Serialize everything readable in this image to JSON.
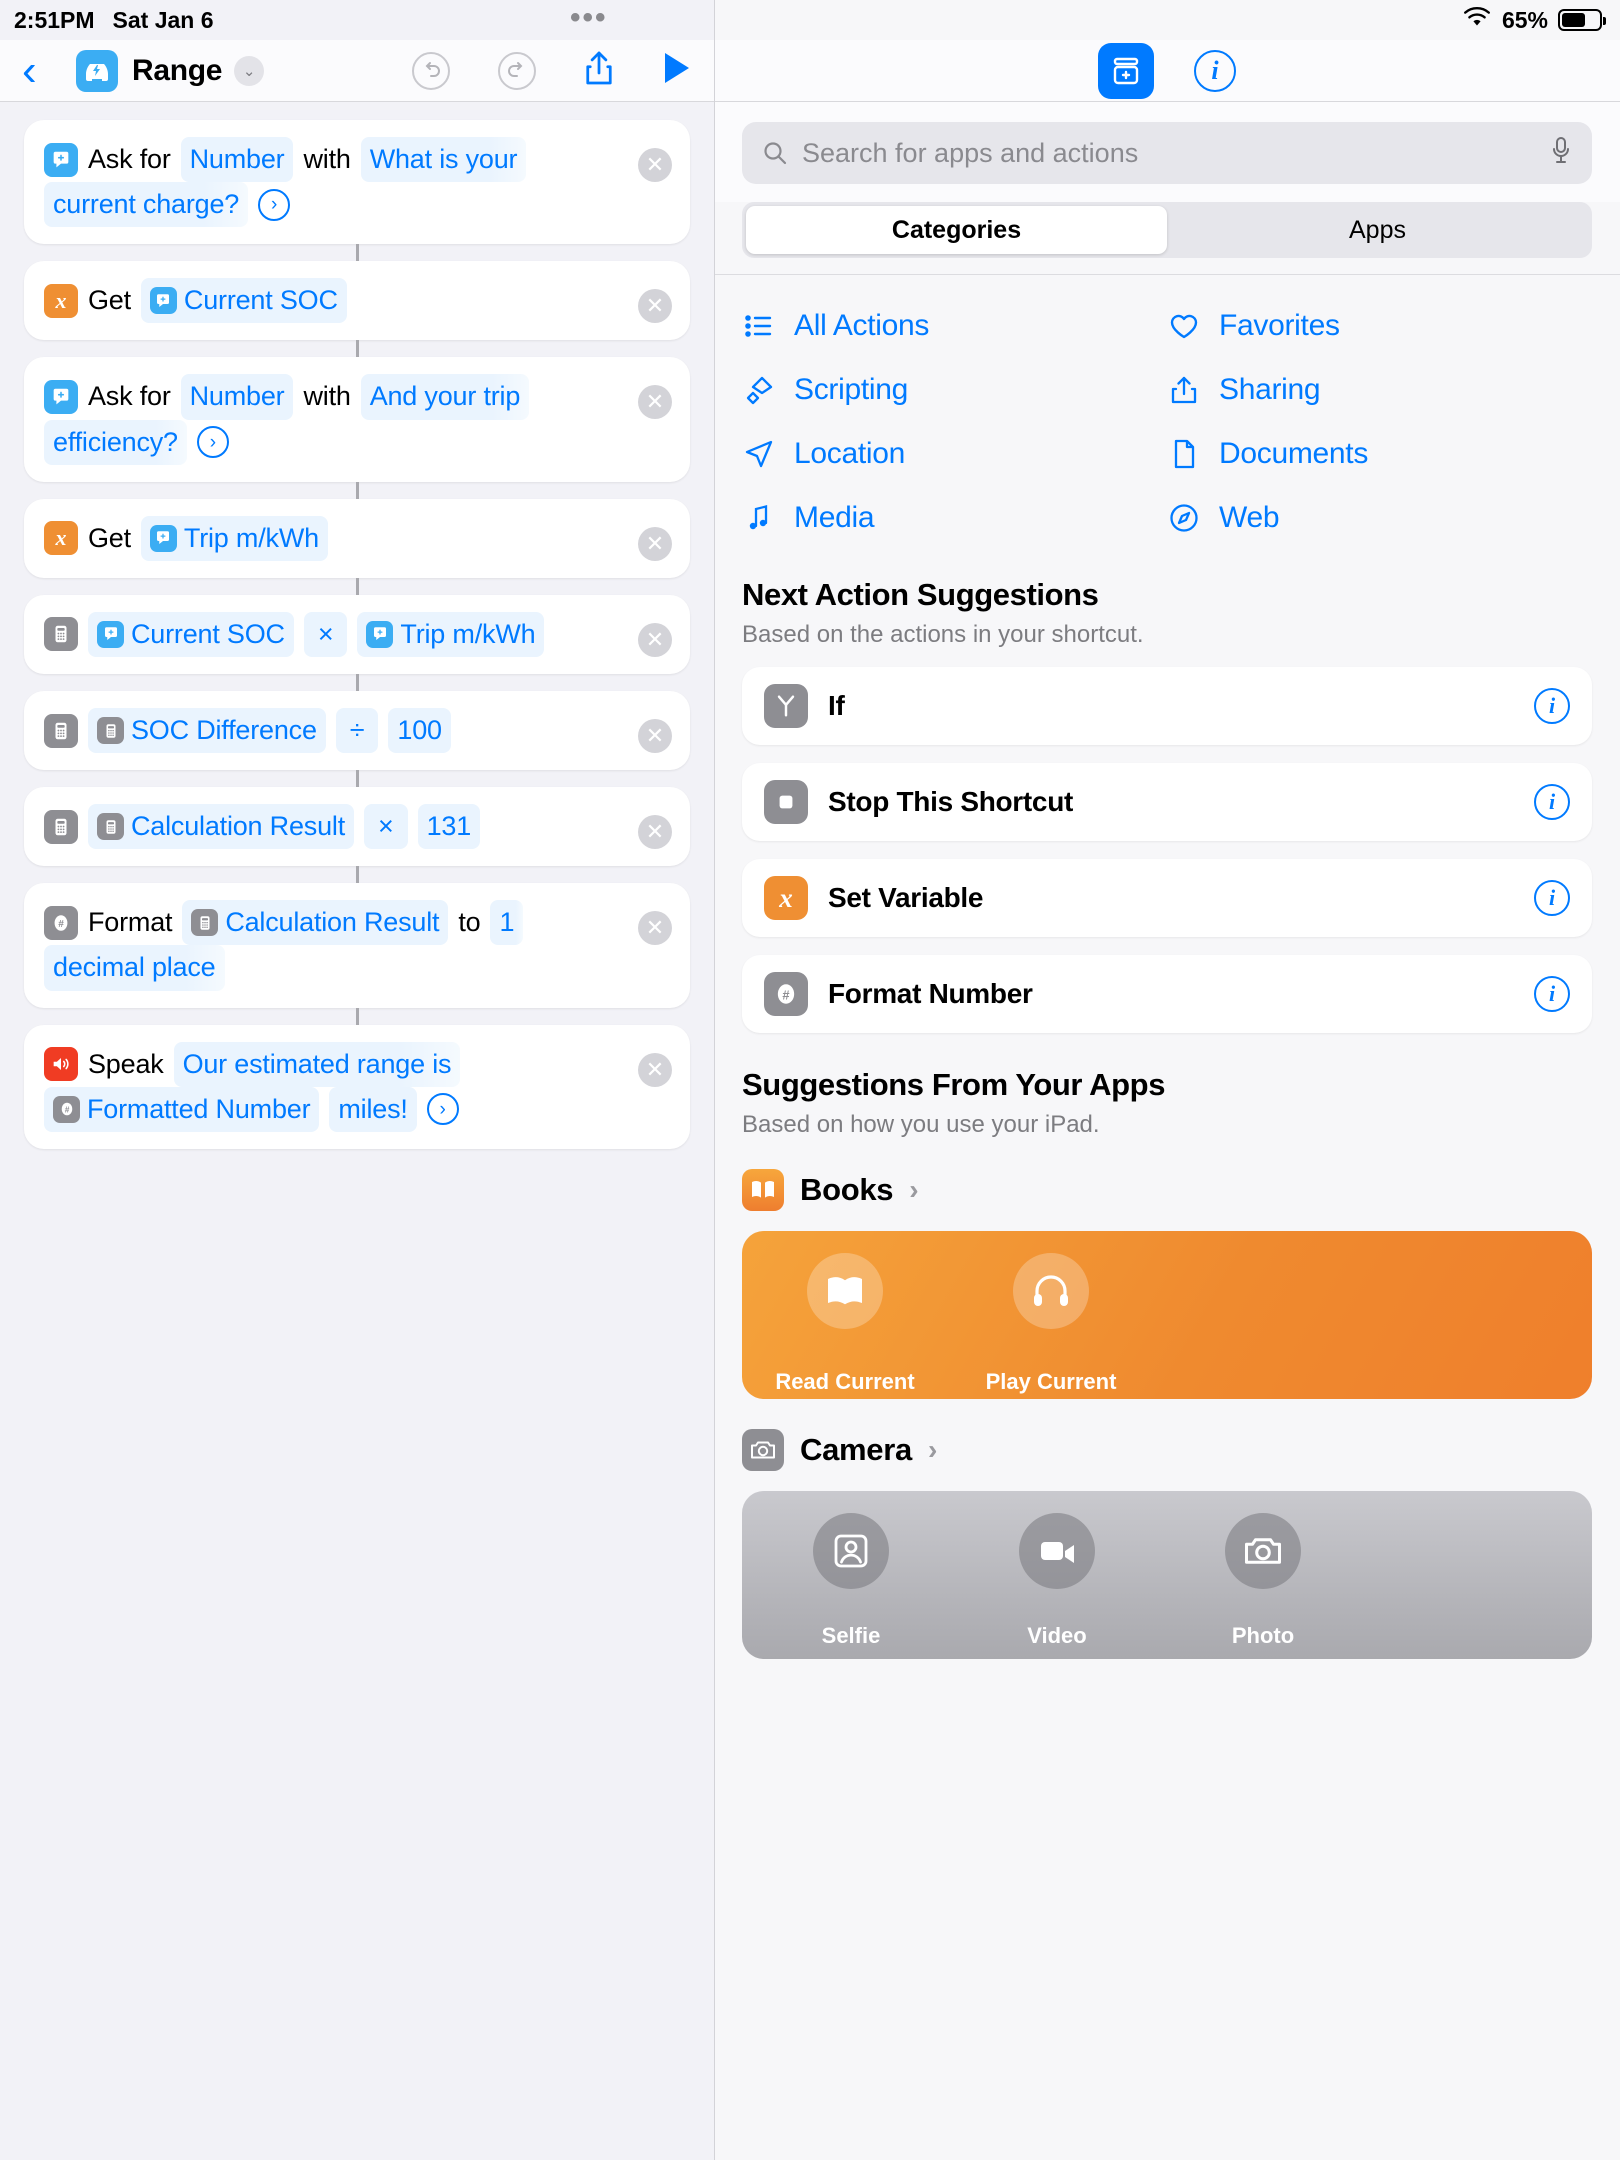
{
  "statusbar": {
    "time": "2:51PM",
    "date": "Sat Jan 6",
    "dots": "•••",
    "battery_percent": "65%"
  },
  "editor": {
    "back_icon": "chevron-left-icon",
    "shortcut_title": "Range",
    "chevron_down": "⌄",
    "undo_label": "↺",
    "redo_label": "↻",
    "actions": [
      {
        "id": "ask-charge",
        "icon": "ask-input-icon",
        "icon_color": "#3badf3",
        "parts": [
          {
            "type": "text",
            "value": "Ask for"
          },
          {
            "type": "token",
            "value": "Number"
          },
          {
            "type": "text",
            "value": "with"
          },
          {
            "type": "token-fill",
            "value": "What is your"
          },
          {
            "type": "break"
          },
          {
            "type": "token-fill",
            "value": "current charge?"
          },
          {
            "type": "arrow",
            "value": "›"
          }
        ]
      },
      {
        "id": "get-current-soc",
        "icon": "variable-x-icon",
        "icon_color": "#ef8f33",
        "parts": [
          {
            "type": "text",
            "value": "Get"
          },
          {
            "type": "token-var",
            "value": "Current SOC",
            "var_icon": "ask-input-icon"
          }
        ]
      },
      {
        "id": "ask-efficiency",
        "icon": "ask-input-icon",
        "icon_color": "#3badf3",
        "parts": [
          {
            "type": "text",
            "value": "Ask for"
          },
          {
            "type": "token",
            "value": "Number"
          },
          {
            "type": "text",
            "value": "with"
          },
          {
            "type": "token-fill",
            "value": "And your trip"
          },
          {
            "type": "break"
          },
          {
            "type": "token-fill",
            "value": "efficiency?"
          },
          {
            "type": "arrow",
            "value": "›"
          }
        ]
      },
      {
        "id": "get-trip-mkwh",
        "icon": "variable-x-icon",
        "icon_color": "#ef8f33",
        "parts": [
          {
            "type": "text",
            "value": "Get"
          },
          {
            "type": "token-var",
            "value": "Trip m/kWh",
            "var_icon": "ask-input-icon"
          }
        ]
      },
      {
        "id": "calc-soc-times-trip",
        "icon": "calculator-icon",
        "icon_color": "#8e8e93",
        "parts": [
          {
            "type": "token-var",
            "value": "Current SOC",
            "var_icon": "ask-input-icon"
          },
          {
            "type": "op",
            "value": "×"
          },
          {
            "type": "token-var",
            "value": "Trip m/kWh",
            "var_icon": "ask-input-icon"
          }
        ]
      },
      {
        "id": "calc-soc-diff-div",
        "icon": "calculator-icon",
        "icon_color": "#8e8e93",
        "parts": [
          {
            "type": "token-calc",
            "value": "SOC Difference",
            "var_icon": "calculator-icon"
          },
          {
            "type": "op",
            "value": "÷"
          },
          {
            "type": "token",
            "value": "100"
          }
        ]
      },
      {
        "id": "calc-result-times-131",
        "icon": "calculator-icon",
        "icon_color": "#8e8e93",
        "parts": [
          {
            "type": "token-calc",
            "value": "Calculation Result",
            "var_icon": "calculator-icon"
          },
          {
            "type": "op",
            "value": "×"
          },
          {
            "type": "token",
            "value": "131"
          }
        ]
      },
      {
        "id": "format-number",
        "icon": "hash-icon",
        "icon_color": "#8e8e93",
        "parts": [
          {
            "type": "text",
            "value": "Format"
          },
          {
            "type": "token-calc",
            "value": "Calculation Result",
            "var_icon": "calculator-icon"
          },
          {
            "type": "text",
            "value": "to"
          },
          {
            "type": "token-fill",
            "value": "1"
          },
          {
            "type": "break"
          },
          {
            "type": "token-fill",
            "value": "decimal place"
          }
        ]
      },
      {
        "id": "speak-text",
        "icon": "speaker-icon",
        "icon_color": "#f03c23",
        "parts": [
          {
            "type": "text",
            "value": "Speak"
          },
          {
            "type": "token-fill",
            "value": "Our estimated range is"
          },
          {
            "type": "break"
          },
          {
            "type": "token-calc",
            "value": "Formatted Number",
            "var_icon": "hash-icon"
          },
          {
            "type": "token-plainblue",
            "value": "miles!"
          },
          {
            "type": "arrow",
            "value": "›"
          }
        ]
      }
    ]
  },
  "library": {
    "toolbar": {
      "library_icon": "add-action-library-icon",
      "info_icon": "info-icon"
    },
    "search": {
      "placeholder": "Search for apps and actions",
      "value": "",
      "search_icon": "search-icon",
      "mic_icon": "microphone-icon"
    },
    "segments": [
      {
        "label": "Categories",
        "active": true
      },
      {
        "label": "Apps",
        "active": false
      }
    ],
    "categories": [
      {
        "label": "All Actions",
        "icon": "list-bullet-icon"
      },
      {
        "label": "Favorites",
        "icon": "heart-icon"
      },
      {
        "label": "Scripting",
        "icon": "scripting-icon"
      },
      {
        "label": "Sharing",
        "icon": "share-icon"
      },
      {
        "label": "Location",
        "icon": "location-arrow-icon"
      },
      {
        "label": "Documents",
        "icon": "document-icon"
      },
      {
        "label": "Media",
        "icon": "music-note-icon"
      },
      {
        "label": "Web",
        "icon": "compass-icon"
      }
    ],
    "next_actions": {
      "title": "Next Action Suggestions",
      "subtitle": "Based on the actions in your shortcut.",
      "items": [
        {
          "label": "If",
          "icon": "branch-icon",
          "icon_style": "gray",
          "info": "info-icon"
        },
        {
          "label": "Stop This Shortcut",
          "icon": "stop-square-icon",
          "icon_style": "gray",
          "info": "info-icon"
        },
        {
          "label": "Set Variable",
          "icon": "variable-x-icon",
          "icon_style": "orange",
          "info": "info-icon"
        },
        {
          "label": "Format Number",
          "icon": "hash-icon",
          "icon_style": "gray",
          "info": "info-icon"
        }
      ]
    },
    "app_suggestions": {
      "title": "Suggestions From Your Apps",
      "subtitle": "Based on how you use your iPad.",
      "apps": [
        {
          "name": "Books",
          "icon": "books-icon",
          "chevron": "›",
          "tiles": [
            {
              "label": "Read Current",
              "icon": "open-book-icon"
            },
            {
              "label": "Play Current",
              "icon": "headphones-icon"
            }
          ]
        },
        {
          "name": "Camera",
          "icon": "camera-icon",
          "chevron": "›",
          "tiles": [
            {
              "label": "Selfie",
              "icon": "portrait-icon"
            },
            {
              "label": "Video",
              "icon": "video-camera-icon"
            },
            {
              "label": "Photo",
              "icon": "camera-icon"
            }
          ]
        }
      ]
    }
  }
}
